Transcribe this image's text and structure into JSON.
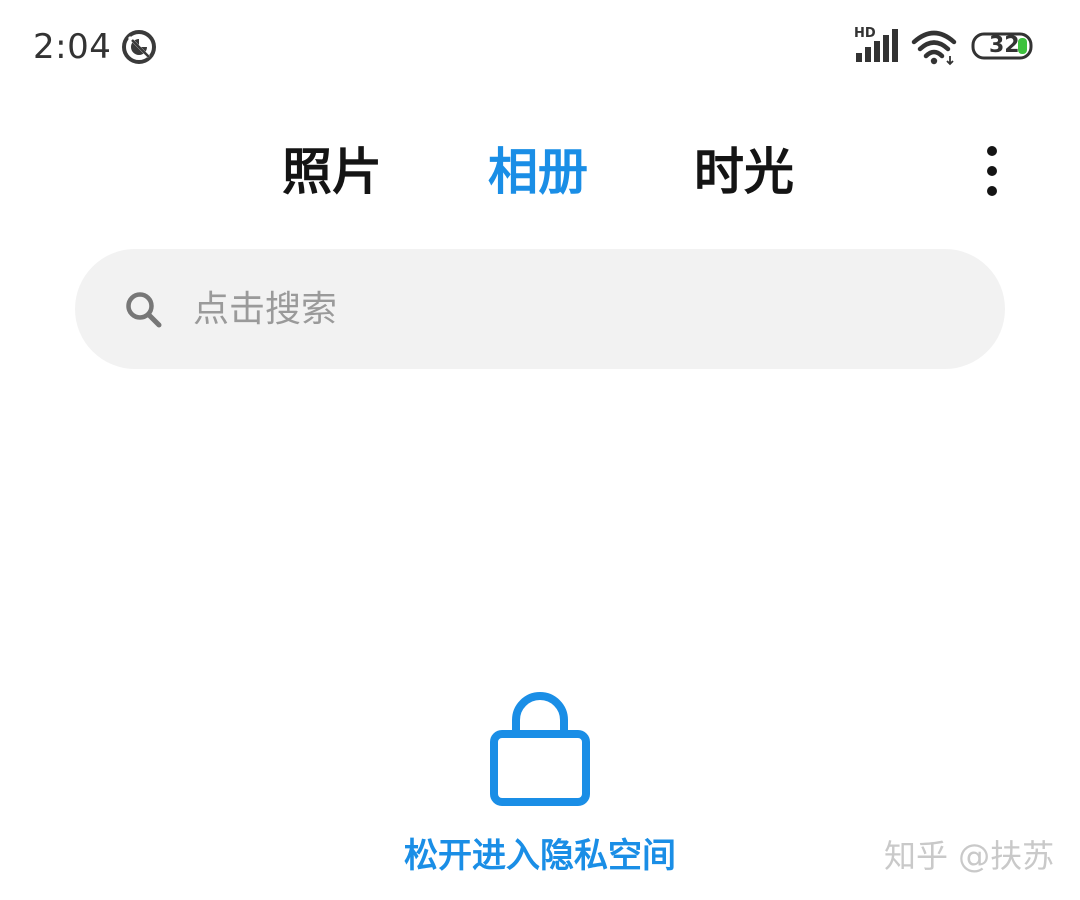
{
  "status_bar": {
    "time": "2:04",
    "network_label": "HD",
    "battery_level": "32",
    "icons": [
      "do-not-disturb-icon",
      "signal-icon",
      "wifi-icon",
      "battery-icon"
    ],
    "battery_charge_color": "#3ec23e"
  },
  "tabs": [
    {
      "label": "照片",
      "active": false
    },
    {
      "label": "相册",
      "active": true
    },
    {
      "label": "时光",
      "active": false
    }
  ],
  "more_menu_icon": "more-vertical-icon",
  "search": {
    "placeholder": "点击搜索",
    "value": "",
    "icon": "search-icon"
  },
  "private_space": {
    "icon": "lock-icon",
    "label": "松开进入隐私空间"
  },
  "watermark": "知乎 @扶苏",
  "colors": {
    "accent": "#1a8ee6",
    "text": "#141414",
    "search_background": "#f2f2f2",
    "placeholder": "#9a9a9a"
  }
}
